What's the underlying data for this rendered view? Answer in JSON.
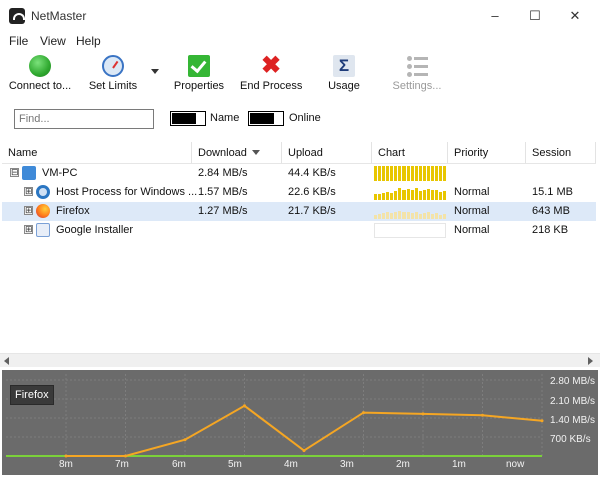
{
  "window": {
    "title": "NetMaster",
    "controls": [
      "–",
      "☐",
      "✕"
    ]
  },
  "menu": [
    "File",
    "View",
    "Help"
  ],
  "toolbar": {
    "connect": "Connect to...",
    "set_limits": "Set Limits",
    "properties": "Properties",
    "end_process": "End Process",
    "usage": "Usage",
    "settings": "Settings..."
  },
  "filter": {
    "find_placeholder": "Find...",
    "toggle_name": "Name",
    "toggle_online": "Online"
  },
  "table": {
    "columns": [
      "Name",
      "Download",
      "Upload",
      "Chart",
      "Priority",
      "Session"
    ],
    "sort_column": "Download",
    "rows": [
      {
        "expander": "⊟",
        "name": "VM-PC",
        "download": "2.84 MB/s",
        "upload": "44.4 KB/s",
        "priority": "",
        "session": "",
        "icon": "computer-icon"
      },
      {
        "expander": "⊞",
        "name": "Host Process for Windows ...",
        "download": "1.57 MB/s",
        "upload": "22.6 KB/s",
        "priority": "Normal",
        "session": "15.1 MB",
        "icon": "gear-icon"
      },
      {
        "expander": "⊞",
        "name": "Firefox",
        "download": "1.27 MB/s",
        "upload": "21.7 KB/s",
        "priority": "Normal",
        "session": "643 MB",
        "icon": "firefox-icon"
      },
      {
        "expander": "⊞",
        "name": "Google Installer",
        "download": "",
        "upload": "",
        "priority": "Normal",
        "session": "218 KB",
        "icon": "google-installer-icon"
      }
    ]
  },
  "graph": {
    "badge": "Firefox",
    "y_ticks": [
      "2.80 MB/s",
      "2.10 MB/s",
      "1.40 MB/s",
      "700 KB/s"
    ],
    "x_ticks": [
      "8m",
      "7m",
      "6m",
      "5m",
      "4m",
      "3m",
      "2m",
      "1m",
      "now"
    ],
    "line_color": "#f5a623",
    "baseline_color": "#7bd13a"
  },
  "chart_data": {
    "type": "line",
    "title": "",
    "xlabel": "",
    "ylabel": "",
    "x": [
      "8m",
      "7m",
      "6m",
      "5m",
      "4m",
      "3m",
      "2m",
      "1m",
      "now"
    ],
    "ylim": [
      0,
      2.8
    ],
    "series": [
      {
        "name": "Firefox",
        "values": [
          0,
          0,
          0.6,
          1.85,
          0.2,
          1.6,
          1.55,
          1.5,
          1.3
        ]
      }
    ]
  }
}
